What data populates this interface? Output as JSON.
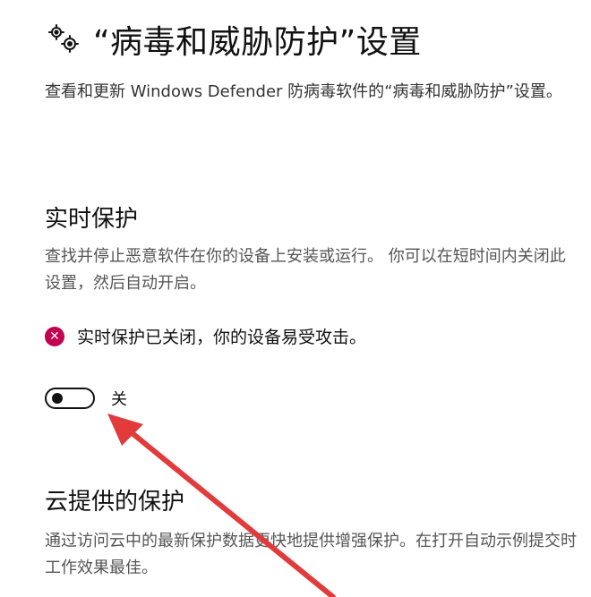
{
  "header": {
    "title": "“病毒和威胁防护”设置",
    "icon": "gear-icon"
  },
  "header_description": "查看和更新 Windows Defender 防病毒软件的“病毒和威胁防护”设置。",
  "realtime_protection": {
    "title": "实时保护",
    "description": "查找并停止恶意软件在你的设备上安装或运行。 你可以在短时间内关闭此设置，然后自动开启。",
    "warning_icon": "error-icon",
    "warning_color": "#c30052",
    "warning_text": "实时保护已关闭，你的设备易受攻击。",
    "toggle_state_label": "关",
    "toggle_on": false
  },
  "cloud_protection": {
    "title": "云提供的保护",
    "description": "通过访问云中的最新保护数据更快地提供增强保护。在打开自动示例提交时工作效果最佳。"
  },
  "annotation": {
    "arrow_color": "#e23b3b"
  }
}
